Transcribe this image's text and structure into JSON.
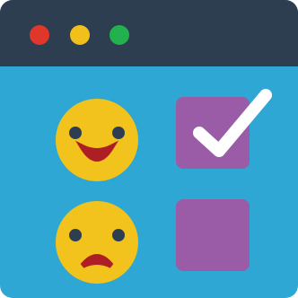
{
  "colors": {
    "window_bg": "#2fa7d4",
    "titlebar_bg": "#2c3e50",
    "close_dot": "#e0372a",
    "minimize_dot": "#f2c01b",
    "maximize_dot": "#22b14c",
    "face_fill": "#f2c31d",
    "face_features": "#ad1f24",
    "face_eyes": "#2c3e50",
    "checkbox_fill": "#9a5ca7",
    "checkmark": "#ffffff"
  },
  "titlebar": {
    "controls": [
      "close-dot",
      "minimize-dot",
      "maximize-dot"
    ]
  },
  "checklist": {
    "items": [
      {
        "icon": "happy-face-icon",
        "checked": true
      },
      {
        "icon": "sad-face-icon",
        "checked": false
      }
    ]
  }
}
